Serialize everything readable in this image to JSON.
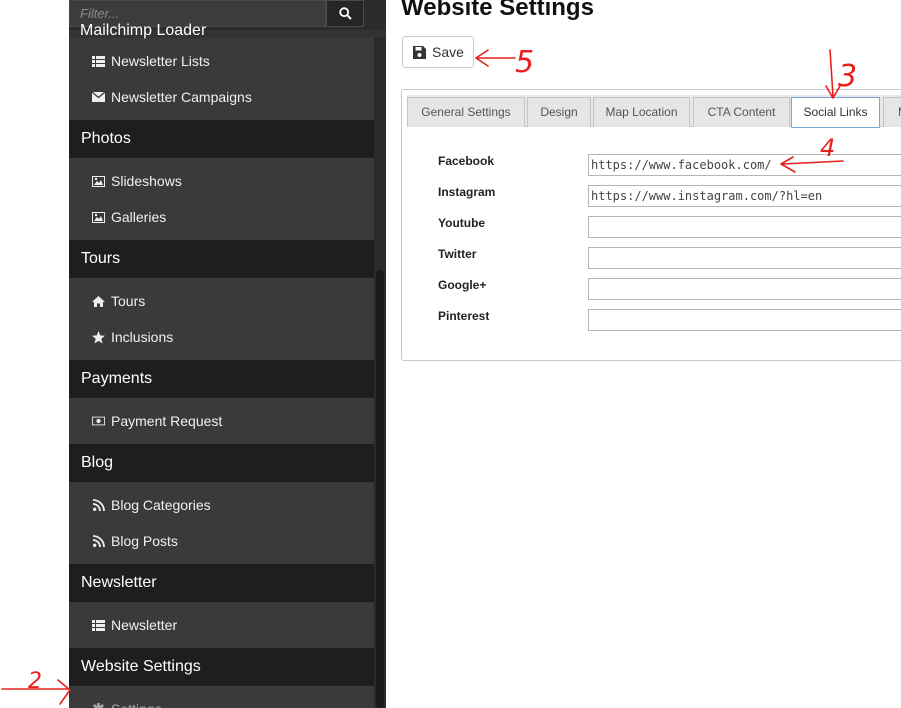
{
  "sidebar": {
    "filter_placeholder": "Filter...",
    "search_icon": "search-icon",
    "cut_section_label": "Mailchimp Loader",
    "sections": [
      {
        "title": "",
        "items": [
          {
            "label": "Newsletter Lists",
            "icon": "list-icon"
          },
          {
            "label": "Newsletter Campaigns",
            "icon": "envelope-icon"
          }
        ]
      },
      {
        "title": "Photos",
        "items": [
          {
            "label": "Slideshows",
            "icon": "image-icon"
          },
          {
            "label": "Galleries",
            "icon": "image-icon"
          }
        ]
      },
      {
        "title": "Tours",
        "items": [
          {
            "label": "Tours",
            "icon": "home-icon"
          },
          {
            "label": "Inclusions",
            "icon": "star-icon"
          }
        ]
      },
      {
        "title": "Payments",
        "items": [
          {
            "label": "Payment Request",
            "icon": "money-icon"
          }
        ]
      },
      {
        "title": "Blog",
        "items": [
          {
            "label": "Blog Categories",
            "icon": "rss-icon"
          },
          {
            "label": "Blog Posts",
            "icon": "rss-icon"
          }
        ]
      },
      {
        "title": "Newsletter",
        "items": [
          {
            "label": "Newsletter",
            "icon": "list-icon"
          }
        ]
      },
      {
        "title": "Website Settings",
        "items": [
          {
            "label": "Settings",
            "icon": "gear-icon"
          }
        ]
      }
    ]
  },
  "main": {
    "title": "Website Settings",
    "save_label": "Save",
    "tabs": [
      "General Settings",
      "Design",
      "Map Location",
      "CTA Content",
      "Social Links",
      "M"
    ],
    "active_tab": "Social Links",
    "fields": [
      {
        "label": "Facebook",
        "value": "https://www.facebook.com/"
      },
      {
        "label": "Instagram",
        "value": "https://www.instagram.com/?hl=en"
      },
      {
        "label": "Youtube",
        "value": ""
      },
      {
        "label": "Twitter",
        "value": ""
      },
      {
        "label": "Google+",
        "value": ""
      },
      {
        "label": "Pinterest",
        "value": ""
      }
    ]
  },
  "annotations": {
    "mark_color": "#e8201c",
    "labels": [
      "2",
      "3",
      "4",
      "5"
    ]
  }
}
